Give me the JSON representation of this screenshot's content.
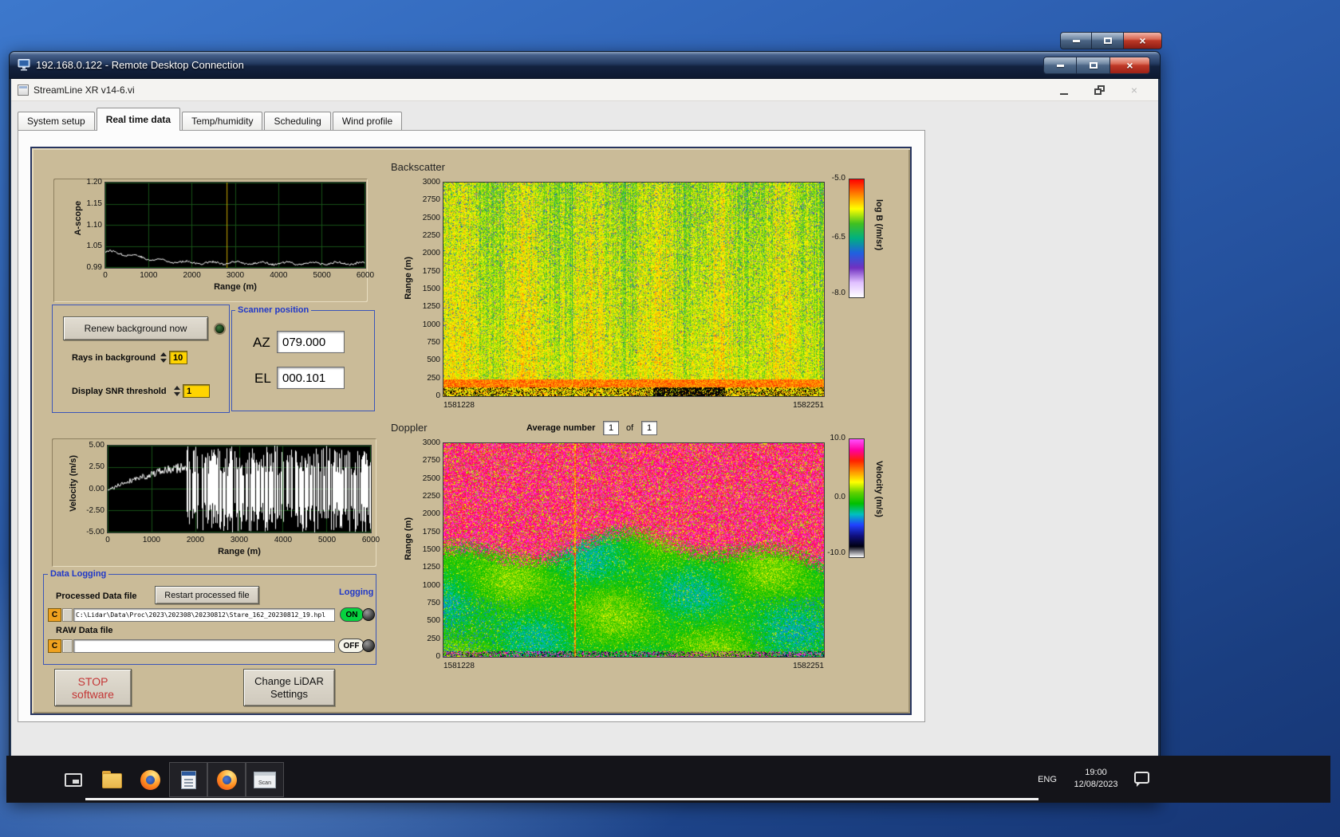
{
  "rdp": {
    "title": "192.168.0.122 - Remote Desktop Connection"
  },
  "app": {
    "title": "StreamLine XR v14-6.vi",
    "active_tab": "Real time data",
    "tabs": [
      {
        "label": "System setup"
      },
      {
        "label": "Real time data"
      },
      {
        "label": "Temp/humidity"
      },
      {
        "label": "Scheduling"
      },
      {
        "label": "Wind profile"
      }
    ]
  },
  "panel": {
    "renew_button": "Renew background now",
    "rays_label": "Rays in background",
    "rays_value": "10",
    "snr_label": "Display SNR threshold",
    "snr_value": "1",
    "scanner": {
      "title": "Scanner position",
      "az_label": "AZ",
      "az_value": "079.000",
      "el_label": "EL",
      "el_value": "000.101"
    },
    "average_label": "Average number",
    "average_value": "1",
    "average_of": "of",
    "average_total": "1",
    "logging": {
      "title": "Data Logging",
      "processed_label": "Processed Data file",
      "restart_button": "Restart processed file",
      "logging_label": "Logging",
      "drive_letter": "C",
      "processed_path": "C:\\Lidar\\Data\\Proc\\2023\\202308\\20230812\\Stare_162_20230812_19.hpl",
      "raw_label": "RAW Data file",
      "raw_path": "",
      "on_label": "ON",
      "off_label": "OFF"
    },
    "stop_line1": "STOP",
    "stop_line2": "software",
    "change_line1": "Change LiDAR",
    "change_line2": "Settings"
  },
  "taskbar": {
    "scan_label": "Scan",
    "language": "ENG",
    "time": "19:00",
    "date": "12/08/2023"
  },
  "chart_data": [
    {
      "id": "ascope",
      "type": "line",
      "ylabel": "A-scope",
      "xlabel": "Range (m)",
      "ylim": [
        0.99,
        1.2
      ],
      "xlim": [
        0,
        6000
      ],
      "yticks": [
        "1.20",
        "1.15",
        "1.10",
        "1.05",
        "0.99"
      ],
      "xticks": [
        "0",
        "1000",
        "2000",
        "3000",
        "4000",
        "5000",
        "6000"
      ],
      "samples_x": [
        0,
        300,
        600,
        1000,
        1500,
        2000,
        2500,
        3000,
        4000,
        5000,
        6000
      ],
      "samples_y": [
        1.03,
        1.027,
        1.021,
        1.012,
        1.006,
        1.003,
        1.002,
        1.002,
        1.001,
        1.001,
        1.001
      ],
      "cursor_x": 2800,
      "trace_color": "#ffffff",
      "cursor_color": "#c8a800",
      "bg": "#000000",
      "grid_color": "#175017",
      "description": "A-scope background trace: ~1.03 at 0 m decaying to ~1.00 by 2500 m, flat with small noise to 6000 m; yellow cursor near 2800 m"
    },
    {
      "id": "backscatter",
      "type": "heatmap",
      "title": "Backscatter",
      "ylabel": "Range (m)",
      "ylim": [
        0,
        3000
      ],
      "yticks": [
        "3000",
        "2750",
        "2500",
        "2250",
        "2000",
        "1750",
        "1500",
        "1250",
        "1000",
        "750",
        "500",
        "250",
        "0"
      ],
      "x_start": "1581228",
      "x_end": "1582251",
      "zlim": [
        -8.0,
        -5.0
      ],
      "colorbar": {
        "label": "log B (/m/sr)",
        "ticks": [
          "-5.0",
          "-6.5",
          "-8.0"
        ],
        "stops_top_to_bottom": [
          "#ff0000",
          "#ff8000",
          "#ffff00",
          "#40c020",
          "#00b080",
          "#2060e0",
          "#7030c0",
          "#e0c0ff",
          "#ffffff"
        ]
      },
      "description": "Speckled yellow-green backscatter field vs time and range; denser dark speckle aloft; intense orange-red aerosol layer below ~250 m with dark ground returns"
    },
    {
      "id": "velocity",
      "type": "line",
      "ylabel": "Velocity (m/s)",
      "xlabel": "Range (m)",
      "ylim": [
        -5,
        5
      ],
      "xlim": [
        0,
        6000
      ],
      "yticks": [
        "5.00",
        "2.50",
        "0.00",
        "-2.50",
        "-5.00"
      ],
      "xticks": [
        "0",
        "1000",
        "2000",
        "3000",
        "4000",
        "5000",
        "6000"
      ],
      "samples_x": [
        0,
        200,
        400,
        700,
        1000,
        1300,
        1600,
        1800
      ],
      "samples_y": [
        -0.2,
        0.3,
        0.8,
        1.3,
        1.7,
        2.1,
        2.4,
        2.5
      ],
      "noise_from": 1800,
      "trace_color": "#ffffff",
      "bg": "#000000",
      "grid_color": "#175017",
      "description": "Doppler velocity vs range: coherent rise to ~2.5 m/s within ~1800 m, uncorrelated full-scale noise beyond"
    },
    {
      "id": "doppler",
      "type": "heatmap",
      "title": "Doppler",
      "ylabel": "Range (m)",
      "ylim": [
        0,
        3000
      ],
      "yticks": [
        "3000",
        "2750",
        "2500",
        "2250",
        "2000",
        "1750",
        "1500",
        "1250",
        "1000",
        "750",
        "500",
        "250",
        "0"
      ],
      "x_start": "1581228",
      "x_end": "1582251",
      "zlim": [
        -10,
        10
      ],
      "colorbar": {
        "label": "Velocity (m/s)",
        "ticks": [
          "10.0",
          "0.0",
          "-10.0"
        ],
        "stops_top_to_bottom": [
          "#ff50ff",
          "#ff00a0",
          "#ff2000",
          "#ff9000",
          "#ffff00",
          "#60d000",
          "#00c000",
          "#00c0c0",
          "#2040ff",
          "#101080",
          "#000010",
          "#ffffff"
        ]
      },
      "description": "Magenta/red uncorrelated noise aloft; coherent green flow below ~1250 m with yellow-green streaks and teal-blue filaments near the surface"
    }
  ]
}
